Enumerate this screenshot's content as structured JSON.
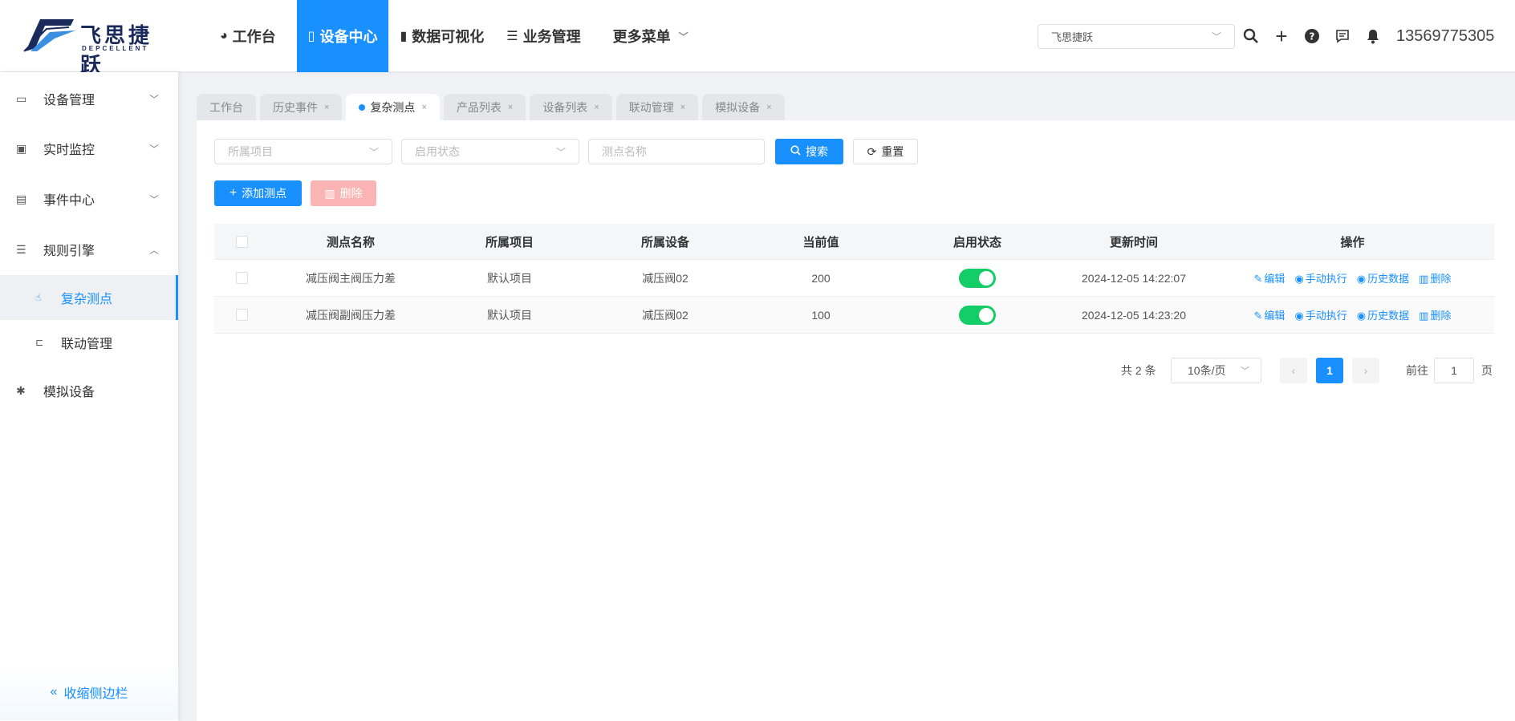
{
  "brand": {
    "name": "飞思捷跃",
    "sub": "DEPCELLENT"
  },
  "topnav": [
    {
      "label": "工作台",
      "icon": "dashboard-icon"
    },
    {
      "label": "设备中心",
      "icon": "mobile-icon",
      "active": true
    },
    {
      "label": "数据可视化",
      "icon": "bar-chart-icon"
    },
    {
      "label": "业务管理",
      "icon": "list-icon"
    },
    {
      "label": "更多菜单",
      "icon": "chevron-down-icon"
    }
  ],
  "header": {
    "org_select": "飞思捷跃",
    "user_phone": "13569775305"
  },
  "sidebar": {
    "items": [
      {
        "label": "设备管理"
      },
      {
        "label": "实时监控"
      },
      {
        "label": "事件中心"
      },
      {
        "label": "规则引擎"
      },
      {
        "label": "复杂测点"
      },
      {
        "label": "联动管理"
      },
      {
        "label": "模拟设备"
      }
    ],
    "collapse_label": "收缩侧边栏"
  },
  "tabs": [
    {
      "label": "工作台"
    },
    {
      "label": "历史事件"
    },
    {
      "label": "复杂测点",
      "active": true
    },
    {
      "label": "产品列表"
    },
    {
      "label": "设备列表"
    },
    {
      "label": "联动管理"
    },
    {
      "label": "模拟设备"
    }
  ],
  "filters": {
    "project_placeholder": "所属项目",
    "status_placeholder": "启用状态",
    "name_placeholder": "测点名称",
    "search_label": "搜索",
    "reset_label": "重置"
  },
  "actions": {
    "add_label": "添加测点",
    "delete_label": "删除"
  },
  "table": {
    "columns": [
      "测点名称",
      "所属项目",
      "所属设备",
      "当前值",
      "启用状态",
      "更新时间",
      "操作"
    ],
    "rows": [
      {
        "name": "减压阀主阀压力差",
        "project": "默认项目",
        "device": "减压阀02",
        "value": "200",
        "enabled": true,
        "time": "2024-12-05 14:22:07"
      },
      {
        "name": "减压阀副阀压力差",
        "project": "默认项目",
        "device": "减压阀02",
        "value": "100",
        "enabled": true,
        "time": "2024-12-05 14:23:20"
      }
    ],
    "ops": {
      "edit": "编辑",
      "run": "手动执行",
      "history": "历史数据",
      "delete": "删除"
    }
  },
  "pagination": {
    "total": "共 2 条",
    "page_size": "10条/页",
    "current": "1",
    "goto_prefix": "前往",
    "goto_value": "1",
    "goto_suffix": "页"
  },
  "colors": {
    "primary": "#1890ff",
    "switch_on": "#13ce66",
    "danger_disabled": "#fbb4b4"
  }
}
